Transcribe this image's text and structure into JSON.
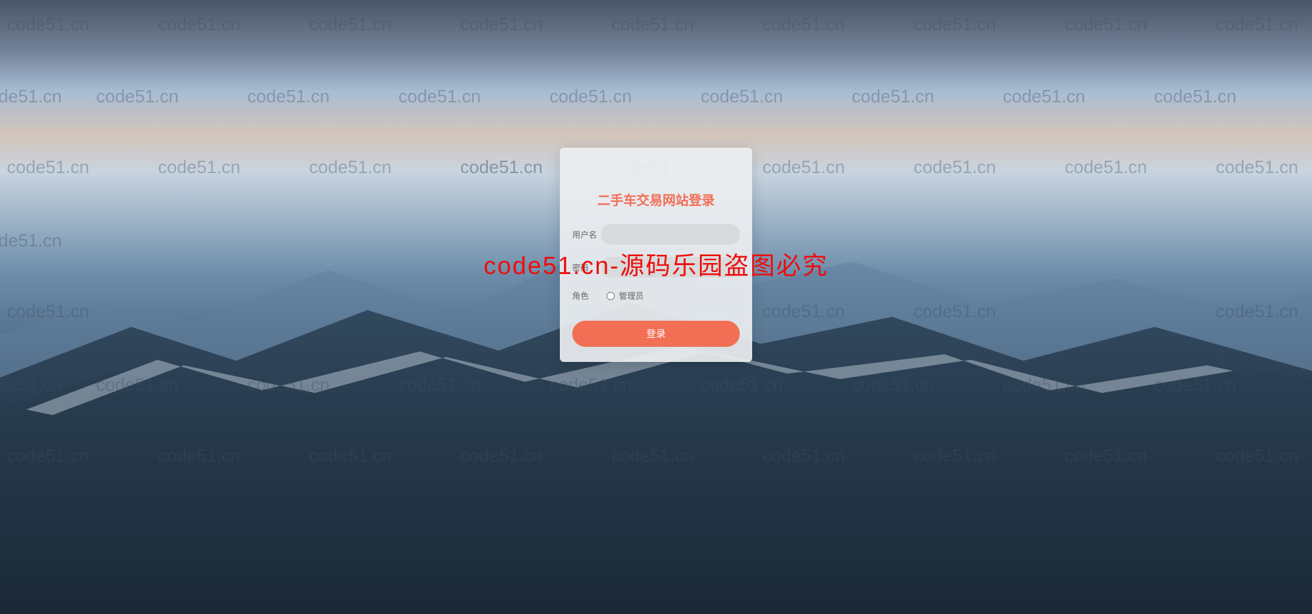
{
  "login": {
    "title": "二手车交易网站登录",
    "username_label": "用户名",
    "username_value": "",
    "password_label": "密码",
    "password_value": "",
    "role_label": "角色",
    "role_option_admin": "管理员",
    "login_button": "登录"
  },
  "watermark": {
    "main": "code51.cn-源码乐园盗图必究",
    "repeat": "code51.cn"
  }
}
